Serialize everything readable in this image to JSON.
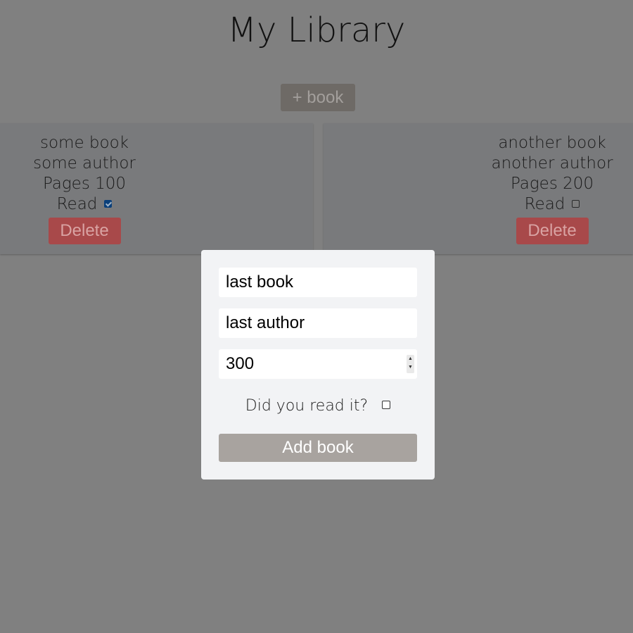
{
  "header": {
    "title": "My Library",
    "add_button_label": "+ book"
  },
  "books": [
    {
      "title": "some book",
      "author": "some author",
      "pages_label": "Pages 100",
      "read_label": "Read",
      "read": true,
      "delete_label": "Delete"
    },
    {
      "title": "another book",
      "author": "another author",
      "pages_label": "Pages 200",
      "read_label": "Read",
      "read": false,
      "delete_label": "Delete"
    }
  ],
  "modal": {
    "title_value": "last book",
    "author_value": "last author",
    "pages_value": "300",
    "read_question": "Did you read it?",
    "read_checked": false,
    "submit_label": "Add book"
  },
  "colors": {
    "overlay": "#808080",
    "modal_bg": "#f2f3f5",
    "delete_button": "#a8494a",
    "submit_button": "#a8a39f"
  }
}
